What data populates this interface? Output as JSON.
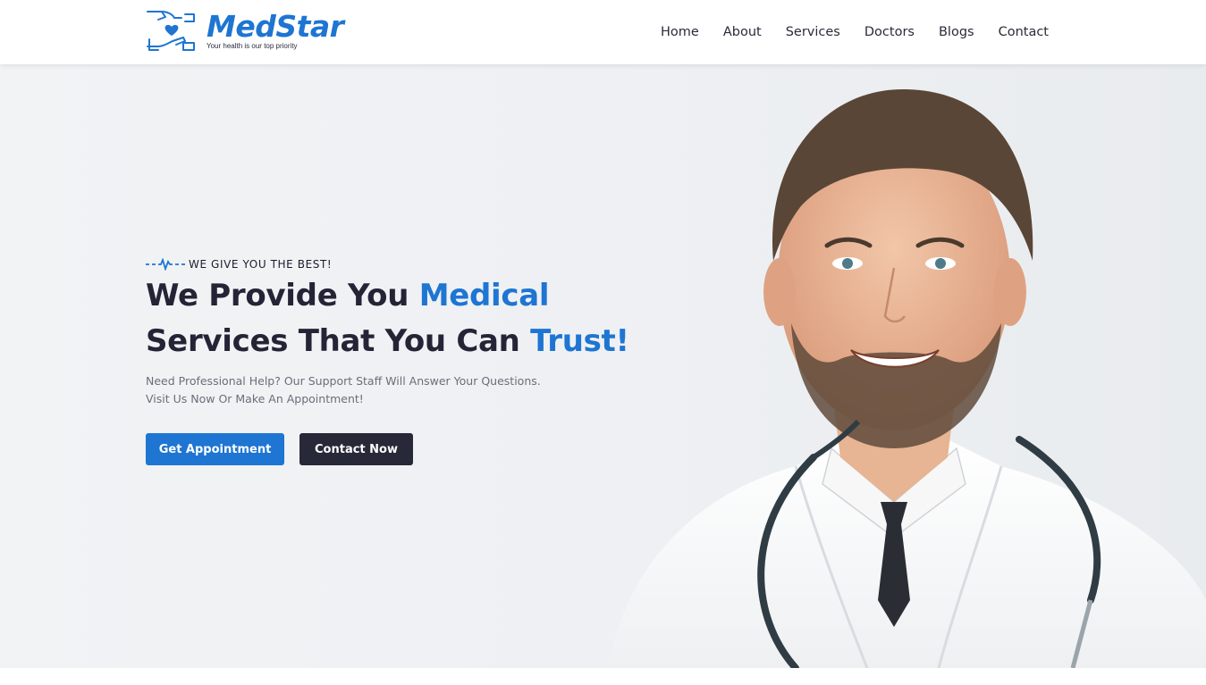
{
  "brand": {
    "name": "MedStar",
    "tagline": "Your health is our top priority",
    "color": "#1e75d2"
  },
  "nav": {
    "items": [
      "Home",
      "About",
      "Services",
      "Doctors",
      "Blogs",
      "Contact"
    ]
  },
  "hero": {
    "eyebrow": "WE GIVE YOU THE BEST!",
    "headline": {
      "line1_dark": "We Provide You ",
      "line1_accent": "Medical",
      "line2_dark": "Services That You Can ",
      "line2_accent": "Trust!"
    },
    "description": {
      "line1": "Need Professional Help? Our Support Staff Will Answer Your Questions.",
      "line2": "Visit Us Now Or Make An Appointment!"
    },
    "primary_button": "Get Appointment",
    "secondary_button": "Contact Now"
  },
  "colors": {
    "accent": "#1e75d2",
    "dark": "#272838",
    "text": "#232536"
  }
}
